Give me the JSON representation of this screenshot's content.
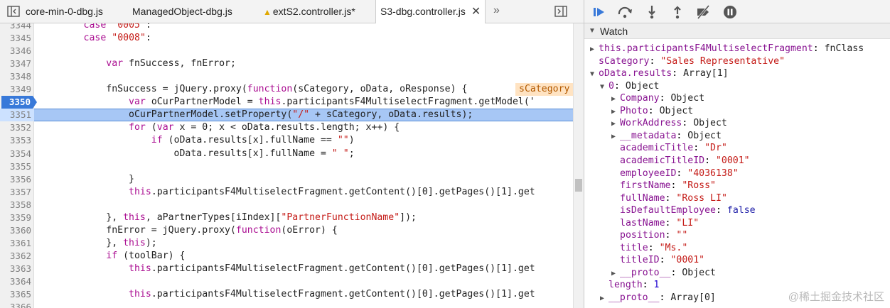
{
  "tabs": [
    {
      "label": "core-min-0-dbg.js",
      "active": false,
      "modified": false
    },
    {
      "label": "ManagedObject-dbg.js",
      "active": false,
      "modified": false
    },
    {
      "label": "extS2.controller.js*",
      "active": false,
      "modified": true
    },
    {
      "label": "S3-dbg.controller.js",
      "active": true,
      "modified": false
    }
  ],
  "more_tabs_label": "»",
  "code_lines": [
    {
      "n": "3344",
      "code": "        case \"0005\":"
    },
    {
      "n": "3345",
      "code": "        case \"0008\":"
    },
    {
      "n": "3346",
      "code": ""
    },
    {
      "n": "3347",
      "code": "            var fnSuccess, fnError;"
    },
    {
      "n": "3348",
      "code": ""
    },
    {
      "n": "3349",
      "code": "            fnSuccess = jQuery.proxy(function(sCategory, oData, oResponse) {"
    },
    {
      "n": "3350",
      "code": "                var oCurPartnerModel = this.participantsF4MultiselectFragment.getModel('"
    },
    {
      "n": "3351",
      "code": "                oCurPartnerModel.setProperty(\"/\" + sCategory, oData.results);"
    },
    {
      "n": "3352",
      "code": "                for (var x = 0; x < oData.results.length; x++) {"
    },
    {
      "n": "3353",
      "code": "                    if (oData.results[x].fullName == \"\")"
    },
    {
      "n": "3354",
      "code": "                        oData.results[x].fullName = \" \";"
    },
    {
      "n": "3355",
      "code": ""
    },
    {
      "n": "3356",
      "code": "                }"
    },
    {
      "n": "3357",
      "code": "                this.participantsF4MultiselectFragment.getContent()[0].getPages()[1].get"
    },
    {
      "n": "3358",
      "code": ""
    },
    {
      "n": "3359",
      "code": "            }, this, aPartnerTypes[iIndex][\"PartnerFunctionName\"]);"
    },
    {
      "n": "3360",
      "code": "            fnError = jQuery.proxy(function(oError) {"
    },
    {
      "n": "3361",
      "code": "            }, this);"
    },
    {
      "n": "3362",
      "code": "            if (toolBar) {"
    },
    {
      "n": "3363",
      "code": "                this.participantsF4MultiselectFragment.getContent()[0].getPages()[1].get"
    },
    {
      "n": "3364",
      "code": ""
    },
    {
      "n": "3365",
      "code": "                this.participantsF4MultiselectFragment.getContent()[0].getPages()[1].get"
    },
    {
      "n": "3366",
      "code": ""
    }
  ],
  "breakpoint_line": "3350",
  "exec_line": "3351",
  "inline_value": "sCategory",
  "inline_value_line": "3349",
  "watch_title": "Watch",
  "watch": [
    {
      "depth": 0,
      "toggle": "collapsed",
      "key": "this.participantsF4MultiselectFragment",
      "value": "fnClass",
      "vtype": "obj"
    },
    {
      "depth": 0,
      "toggle": "none",
      "key": "sCategory",
      "value": "\"Sales Representative\"",
      "vtype": "str"
    },
    {
      "depth": 0,
      "toggle": "expanded",
      "key": "oData.results",
      "value": "Array[1]",
      "vtype": "obj"
    },
    {
      "depth": 1,
      "toggle": "expanded",
      "key": "0",
      "value": "Object",
      "vtype": "obj"
    },
    {
      "depth": 2,
      "toggle": "collapsed",
      "key": "Company",
      "value": "Object",
      "vtype": "obj"
    },
    {
      "depth": 2,
      "toggle": "collapsed",
      "key": "Photo",
      "value": "Object",
      "vtype": "obj"
    },
    {
      "depth": 2,
      "toggle": "collapsed",
      "key": "WorkAddress",
      "value": "Object",
      "vtype": "obj"
    },
    {
      "depth": 2,
      "toggle": "collapsed",
      "key": "__metadata",
      "value": "Object",
      "vtype": "obj"
    },
    {
      "depth": 2,
      "toggle": "none",
      "key": "academicTitle",
      "value": "\"Dr\"",
      "vtype": "str"
    },
    {
      "depth": 2,
      "toggle": "none",
      "key": "academicTitleID",
      "value": "\"0001\"",
      "vtype": "str"
    },
    {
      "depth": 2,
      "toggle": "none",
      "key": "employeeID",
      "value": "\"4036138\"",
      "vtype": "str"
    },
    {
      "depth": 2,
      "toggle": "none",
      "key": "firstName",
      "value": "\"Ross\"",
      "vtype": "str"
    },
    {
      "depth": 2,
      "toggle": "none",
      "key": "fullName",
      "value": "\"Ross LI\"",
      "vtype": "str"
    },
    {
      "depth": 2,
      "toggle": "none",
      "key": "isDefaultEmployee",
      "value": "false",
      "vtype": "kw"
    },
    {
      "depth": 2,
      "toggle": "none",
      "key": "lastName",
      "value": "\"LI\"",
      "vtype": "str"
    },
    {
      "depth": 2,
      "toggle": "none",
      "key": "position",
      "value": "\"\"",
      "vtype": "str"
    },
    {
      "depth": 2,
      "toggle": "none",
      "key": "title",
      "value": "\"Ms.\"",
      "vtype": "str"
    },
    {
      "depth": 2,
      "toggle": "none",
      "key": "titleID",
      "value": "\"0001\"",
      "vtype": "str"
    },
    {
      "depth": 2,
      "toggle": "collapsed",
      "key": "__proto__",
      "value": "Object",
      "vtype": "obj"
    },
    {
      "depth": 1,
      "toggle": "none",
      "key": "length",
      "value": "1",
      "vtype": "num"
    },
    {
      "depth": 1,
      "toggle": "collapsed",
      "key": "__proto__",
      "value": "Array[0]",
      "vtype": "obj"
    }
  ],
  "watermark": "@稀土掘金技术社区",
  "colors": {
    "accent": "#3879d9",
    "exec_highlight": "#a7c7f5"
  }
}
